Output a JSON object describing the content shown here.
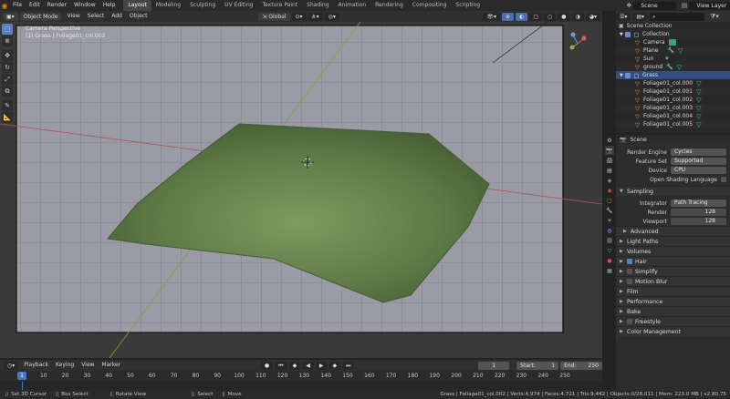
{
  "menubar": {
    "items": [
      "File",
      "Edit",
      "Render",
      "Window",
      "Help"
    ],
    "workspaces": [
      "Layout",
      "Modeling",
      "Sculpting",
      "UV Editing",
      "Texture Paint",
      "Shading",
      "Animation",
      "Rendering",
      "Compositing",
      "Scripting"
    ],
    "active_workspace": "Layout",
    "scene": "Scene",
    "view_layer": "View Layer"
  },
  "viewport_header": {
    "mode": "Object Mode",
    "menus": [
      "View",
      "Select",
      "Add",
      "Object"
    ],
    "transform": "Global"
  },
  "viewport": {
    "info_line1": "Camera Perspective",
    "info_line2": "(1) Grass | Foliage01_col.002"
  },
  "outliner": {
    "root": "Scene Collection",
    "rows": [
      {
        "label": "Collection",
        "icon": "collection-icon"
      },
      {
        "label": "Camera",
        "icon": "camera-icon"
      },
      {
        "label": "Plane",
        "icon": "object-icon"
      },
      {
        "label": "Sun",
        "icon": "light-icon"
      },
      {
        "label": "ground",
        "icon": "object-icon"
      },
      {
        "label": "Grass",
        "icon": "collection-icon"
      },
      {
        "label": "Foliage01_col.000",
        "icon": "object-icon"
      },
      {
        "label": "Foliage01_col.001",
        "icon": "object-icon"
      },
      {
        "label": "Foliage01_col.002",
        "icon": "object-icon"
      },
      {
        "label": "Foliage01_col.003",
        "icon": "object-icon"
      },
      {
        "label": "Foliage01_col.004",
        "icon": "object-icon"
      },
      {
        "label": "Foliage01_col.005",
        "icon": "object-icon"
      }
    ]
  },
  "properties": {
    "header": "Scene",
    "render_engine_label": "Render Engine",
    "render_engine": "Cycles",
    "feature_set_label": "Feature Set",
    "feature_set": "Supported",
    "device_label": "Device",
    "device": "CPU",
    "osl": "Open Shading Language",
    "sampling": "Sampling",
    "integrator_label": "Integrator",
    "integrator": "Path Tracing",
    "render_label": "Render",
    "render_samples": "128",
    "viewport_label": "Viewport",
    "viewport_samples": "128",
    "advanced": "Advanced",
    "light_paths": "Light Paths",
    "volumes": "Volumes",
    "hair": "Hair",
    "simplify": "Simplify",
    "motion_blur": "Motion Blur",
    "film": "Film",
    "performance": "Performance",
    "bake": "Bake",
    "freestyle": "Freestyle",
    "color_management": "Color Management"
  },
  "timeline": {
    "menus": [
      "Playback",
      "Keying",
      "View",
      "Marker"
    ],
    "current_frame": "1",
    "start_label": "Start:",
    "start": "1",
    "end_label": "End:",
    "end": "250",
    "ticks": [
      "1",
      "10",
      "20",
      "30",
      "40",
      "50",
      "60",
      "70",
      "80",
      "90",
      "100",
      "110",
      "120",
      "130",
      "140",
      "150",
      "160",
      "170",
      "180",
      "190",
      "200",
      "210",
      "220",
      "230",
      "240",
      "250"
    ]
  },
  "statusbar": {
    "hint1": "Set 3D Cursor",
    "hint2": "Box Select",
    "hint3": "Rotate View",
    "hint4": "Select",
    "hint5": "Move",
    "stats": "Grass | Foliage01_col.002 | Verts:4,974 | Faces:4,721 | Tris:9,442 | Objects:0/28,011 | Mem: 223.0 MB | v2.80.75"
  }
}
